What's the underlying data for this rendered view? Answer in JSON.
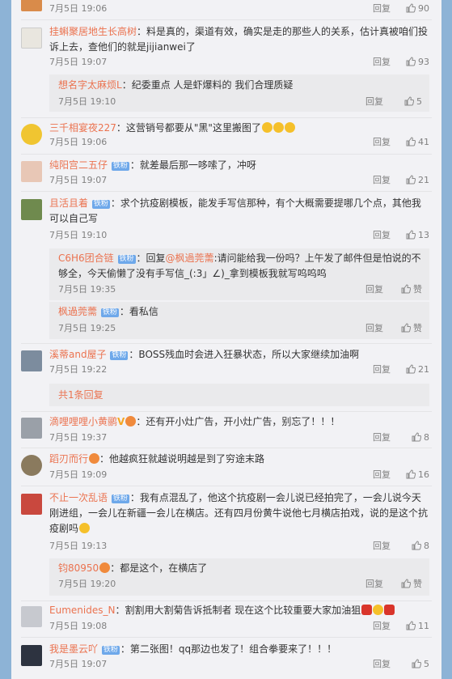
{
  "common": {
    "reply_label": "回复",
    "like_label": "赞"
  },
  "colors": {
    "username": "#eb7350",
    "meta": "#808080",
    "badge": "#6ea8ea",
    "panel": "#f2f2f5",
    "background": "#8db3d6"
  },
  "comments": [
    {
      "time": "7月5日 19:06",
      "likes": "90"
    },
    {
      "user": "挂蝌聚居地生长高树",
      "text": "：料是真的，渠道有效，确实是走的那些人的关系，估计真被咱们投诉上去，查他们的就是jijianwei了",
      "time": "7月5日 19:07",
      "likes": "93"
    },
    {
      "user": "想名字太麻烦L",
      "text": "：纪委重点 人是虾爆料的 我们合理质疑",
      "time": "7月5日 19:10",
      "likes": "5"
    },
    {
      "user": "三千相宴夜227",
      "text": "：这营销号都要从\"黑\"这里搬图了",
      "time": "7月5日 19:06",
      "likes": "41"
    },
    {
      "user": "纯阳宫二五仔",
      "badge": "铁粉",
      "text": "：就差最后那一哆嗦了，冲呀",
      "time": "7月5日 19:07",
      "likes": "21"
    },
    {
      "user": "且活且着",
      "badge": "铁粉",
      "text": "：求个抗疫剧模板，能发手写信那种，有个大概需要提哪几个点，其他我可以自己写",
      "time": "7月5日 19:10",
      "likes": "13"
    },
    {
      "user": "C6H6团合链",
      "badge": "铁粉",
      "text_a": "：回复",
      "mention": "@枫過莞薷",
      "text_b": ":请问能给我一份吗？上午发了邮件但是怕说的不够全，今天偷懒了没有手写信_(:3」∠)_拿到模板我就写呜呜呜",
      "time": "7月5日 19:35"
    },
    {
      "user": "枫過莞薷",
      "badge": "铁粉",
      "text": "：看私信",
      "time": "7月5日 19:25"
    },
    {
      "user": "溪蒂and屋子",
      "badge": "铁粉",
      "text": "：BOSS残血时会进入狂暴状态，所以大家继续加油啊",
      "time": "7月5日 19:22",
      "likes": "21"
    },
    {
      "more": "共1条回复"
    },
    {
      "user": "滴哩哩哩小黄鹂",
      "text": "：还有开小灶广告，开小灶广告，别忘了！！！",
      "time": "7月5日 19:37",
      "likes": "8"
    },
    {
      "user": "蹈刃而行",
      "text": "：他越疯狂就越说明越是到了穷途末路",
      "time": "7月5日 19:09",
      "likes": "16"
    },
    {
      "user": "不止一次乱语",
      "badge": "铁粉",
      "text": "：我有点混乱了，他这个抗疫剧一会儿说已经拍完了，一会儿说今天刚进组，一会儿在新疆一会儿在横店。还有四月份黄牛说他七月横店拍戏，说的是这个抗疫剧吗",
      "time": "7月5日 19:13",
      "likes": "8"
    },
    {
      "user": "钧80950",
      "text": "：都是这个，在横店了",
      "time": "7月5日 19:20"
    },
    {
      "user": "Eumenides_N",
      "text": "：割割用大割菊告诉抵制者 现在这个比较重要大家加油狙",
      "time": "7月5日 19:08",
      "likes": "11"
    },
    {
      "user": "我是墨云吖",
      "badge": "铁粉",
      "text": "：第二张图！qq那边也发了！组合拳要来了！！！",
      "time": "7月5日 19:07",
      "likes": "5"
    }
  ]
}
